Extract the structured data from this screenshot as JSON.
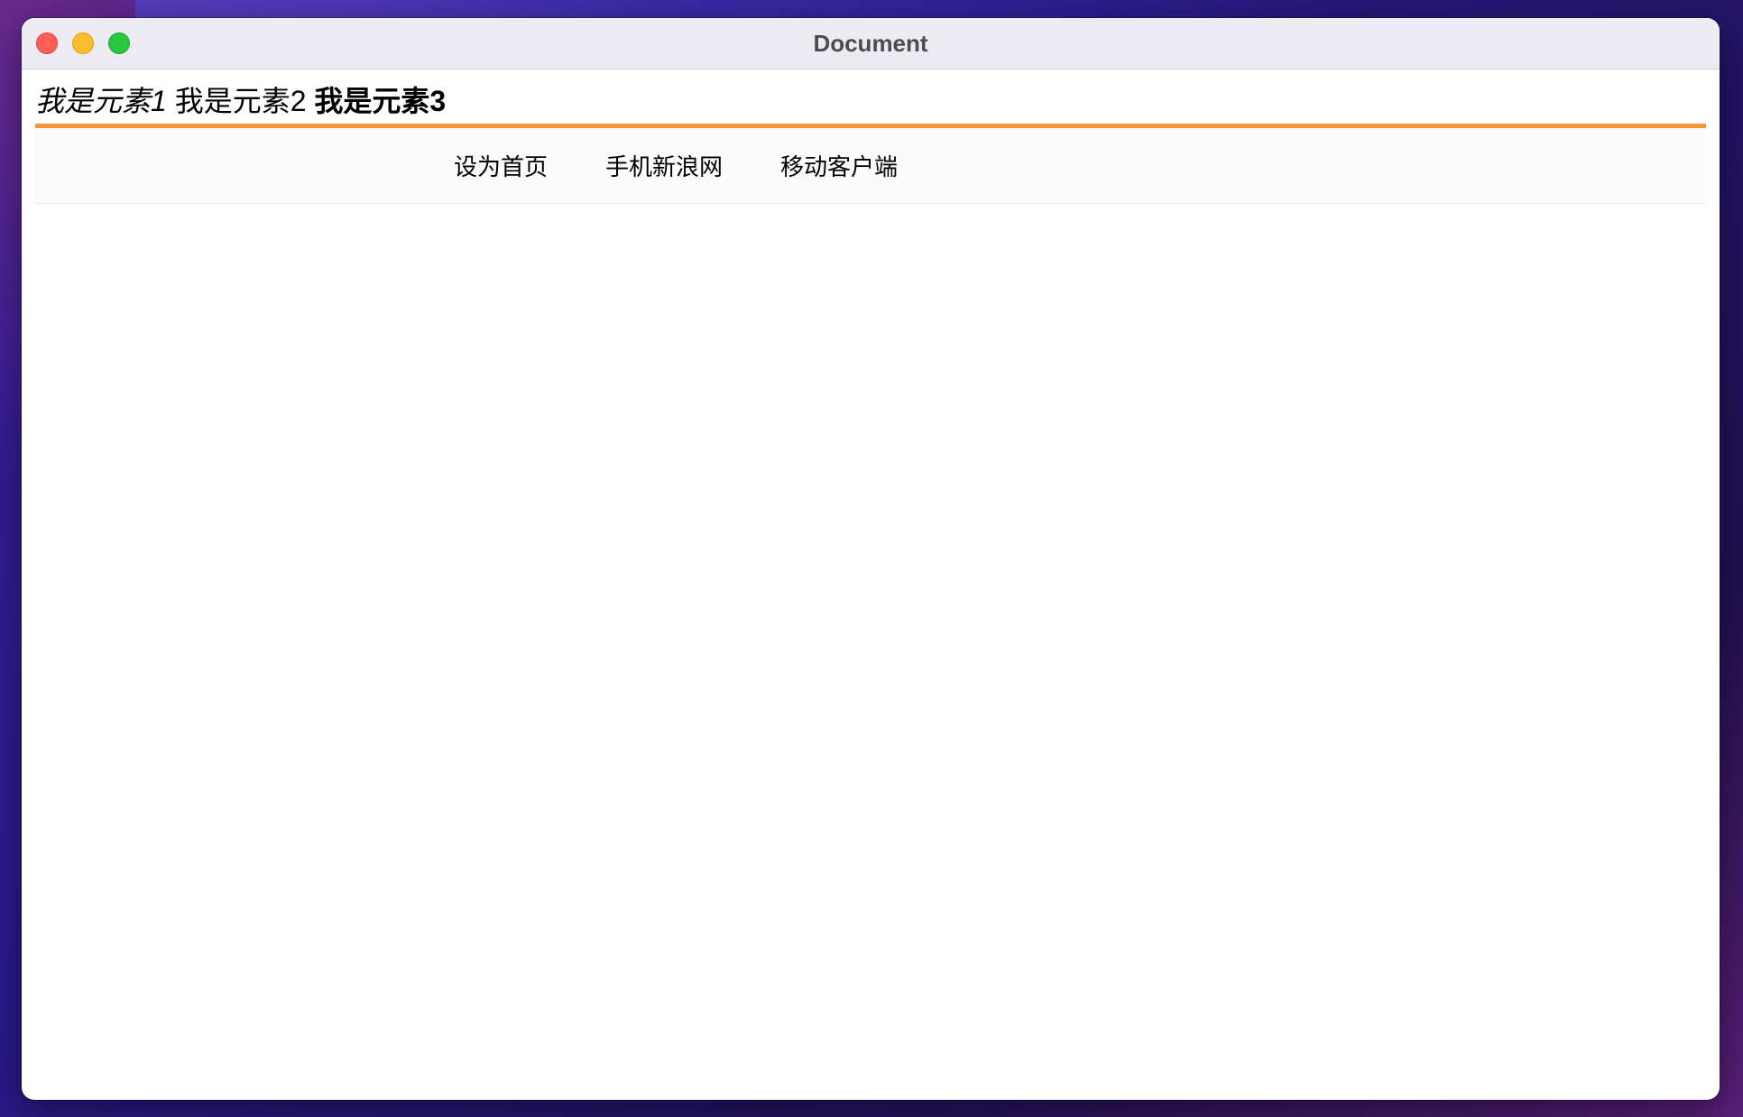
{
  "window": {
    "title": "Document"
  },
  "elements": {
    "el1": "我是元素1",
    "el2": "我是元素2",
    "el3": "我是元素3"
  },
  "nav": {
    "accent_color": "#fc9432",
    "links": [
      {
        "label": "设为首页"
      },
      {
        "label": "手机新浪网"
      },
      {
        "label": "移动客户端"
      }
    ]
  }
}
